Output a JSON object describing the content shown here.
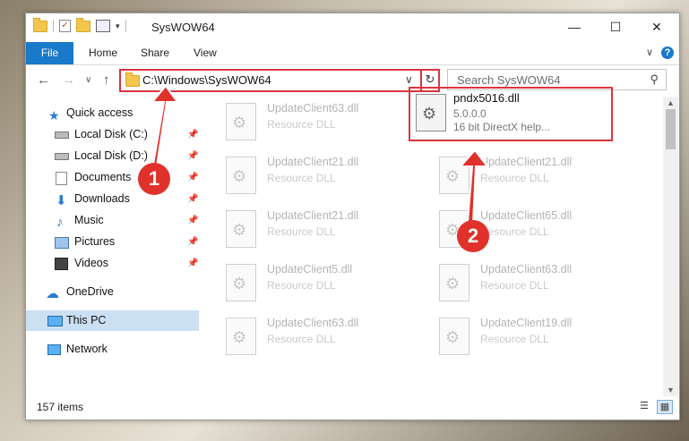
{
  "window": {
    "title": "SysWOW64",
    "controls": {
      "minimize": "—",
      "maximize": "☐",
      "close": "✕"
    }
  },
  "ribbon": {
    "tabs": [
      "File",
      "Home",
      "Share",
      "View"
    ],
    "help": "?",
    "expand": "∨"
  },
  "nav": {
    "back": "←",
    "forward": "→",
    "recent": "∨",
    "up": "↑",
    "address": "C:\\Windows\\SysWOW64",
    "address_dropdown": "∨",
    "refresh": "↻",
    "search_placeholder": "Search SysWOW64",
    "search_icon": "⚲"
  },
  "sidebar": {
    "items": [
      {
        "label": "Quick access",
        "icon": "star-icon",
        "pinned": false
      },
      {
        "label": "Local Disk (C:)",
        "icon": "drive-icon",
        "pinned": true
      },
      {
        "label": "Local Disk (D:)",
        "icon": "drive-icon",
        "pinned": true
      },
      {
        "label": "Documents",
        "icon": "documents-icon",
        "pinned": true
      },
      {
        "label": "Downloads",
        "icon": "download-icon",
        "pinned": true
      },
      {
        "label": "Music",
        "icon": "music-icon",
        "pinned": true
      },
      {
        "label": "Pictures",
        "icon": "pictures-icon",
        "pinned": true
      },
      {
        "label": "Videos",
        "icon": "videos-icon",
        "pinned": true
      },
      {
        "label": "OneDrive",
        "icon": "cloud-icon",
        "pinned": false
      },
      {
        "label": "This PC",
        "icon": "computer-icon",
        "pinned": false,
        "selected": true
      },
      {
        "label": "Network",
        "icon": "network-icon",
        "pinned": false
      }
    ]
  },
  "files": [
    {
      "name": "UpdateClient63.dll",
      "type": "Resource DLL"
    },
    {
      "name": "UpdateClient21.dll",
      "type": "Resource DLL"
    },
    {
      "name": "UpdateClient21.dll",
      "type": "Resource DLL"
    },
    {
      "name": "UpdateClient21.dll",
      "type": "Resource DLL"
    },
    {
      "name": "UpdateClient65.dll",
      "type": "Resource DLL"
    },
    {
      "name": "UpdateClient5.dll",
      "type": "Resource DLL"
    },
    {
      "name": "UpdateClient63.dll",
      "type": "Resource DLL"
    },
    {
      "name": "UpdateClient63.dll",
      "type": "Resource DLL"
    },
    {
      "name": "UpdateClient19.dll",
      "type": "Resource DLL"
    }
  ],
  "highlighted_file": {
    "name": "pndx5016.dll",
    "version": "5.0.0.0",
    "description": "16 bit DirectX help..."
  },
  "status": {
    "count": "157 items"
  },
  "annotations": {
    "step1": "1",
    "step2": "2",
    "color": "#e0312b"
  },
  "colors": {
    "accent": "#1979ca",
    "highlight_border": "#d9363e",
    "selected_bg": "#cce0f4"
  }
}
